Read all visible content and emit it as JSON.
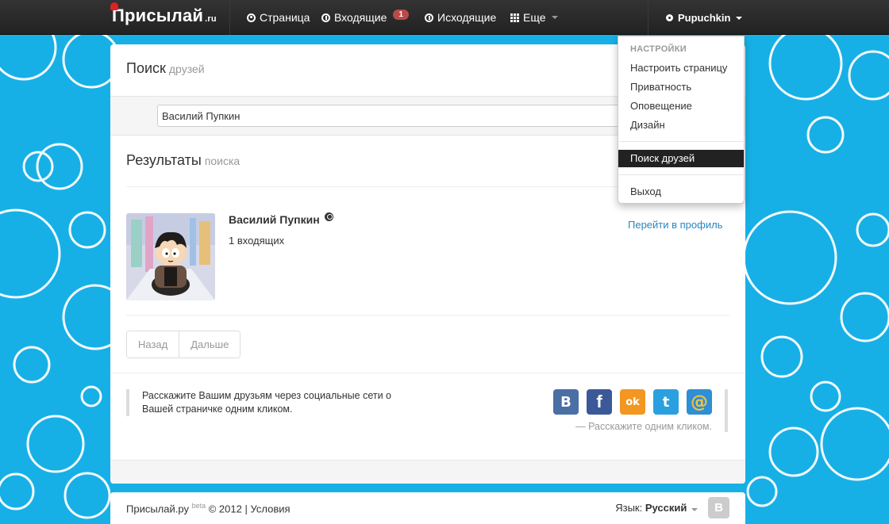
{
  "nav": {
    "brand": "Присылай",
    "brand_suffix": ".ru",
    "items": [
      {
        "label": "Страница",
        "icon": "circle-icon"
      },
      {
        "label": "Входящие",
        "icon": "info-icon",
        "badge": "1"
      },
      {
        "label": "Исходящие",
        "icon": "info-icon"
      },
      {
        "label": "Еще",
        "icon": "grid-icon"
      }
    ],
    "user": "Pupuchkin"
  },
  "dropdown": {
    "header": "НАСТРОЙКИ",
    "items": [
      "Настроить страницу",
      "Приватность",
      "Оповещение",
      "Дизайн"
    ],
    "active_item": "Поиск друзей",
    "logout": "Выход"
  },
  "search": {
    "title": "Поиск",
    "title_small": "друзей",
    "input_value": "Василий Пупкин"
  },
  "results": {
    "title": "Результаты",
    "title_small": "поиска",
    "items": [
      {
        "name": "Василий Пупкин",
        "meta": "1 входящих",
        "link": "Перейти в профиль"
      }
    ]
  },
  "pager": {
    "prev": "Назад",
    "next": "Дальше"
  },
  "share": {
    "text": "Расскажите Вашим друзьям через социальные сети о Вашей страничке одним кликом.",
    "caption": "— Расскажите одним кликом.",
    "buttons": [
      {
        "name": "vk",
        "glyph": "В",
        "color": "#4a6fa5"
      },
      {
        "name": "facebook",
        "glyph": "f",
        "color": "#3b5998"
      },
      {
        "name": "odnoklassniki",
        "glyph": "ok",
        "color": "#f29722"
      },
      {
        "name": "twitter",
        "glyph": "t",
        "color": "#2ba0e0"
      },
      {
        "name": "mailru",
        "glyph": "@",
        "color": "#2d8fd5"
      }
    ]
  },
  "footer": {
    "site": "Присылай.ру",
    "beta": "beta",
    "copyright": "© 2012 |",
    "terms": "Условия",
    "lang_label": "Язык:",
    "lang_value": "Русский",
    "vk": "В"
  }
}
